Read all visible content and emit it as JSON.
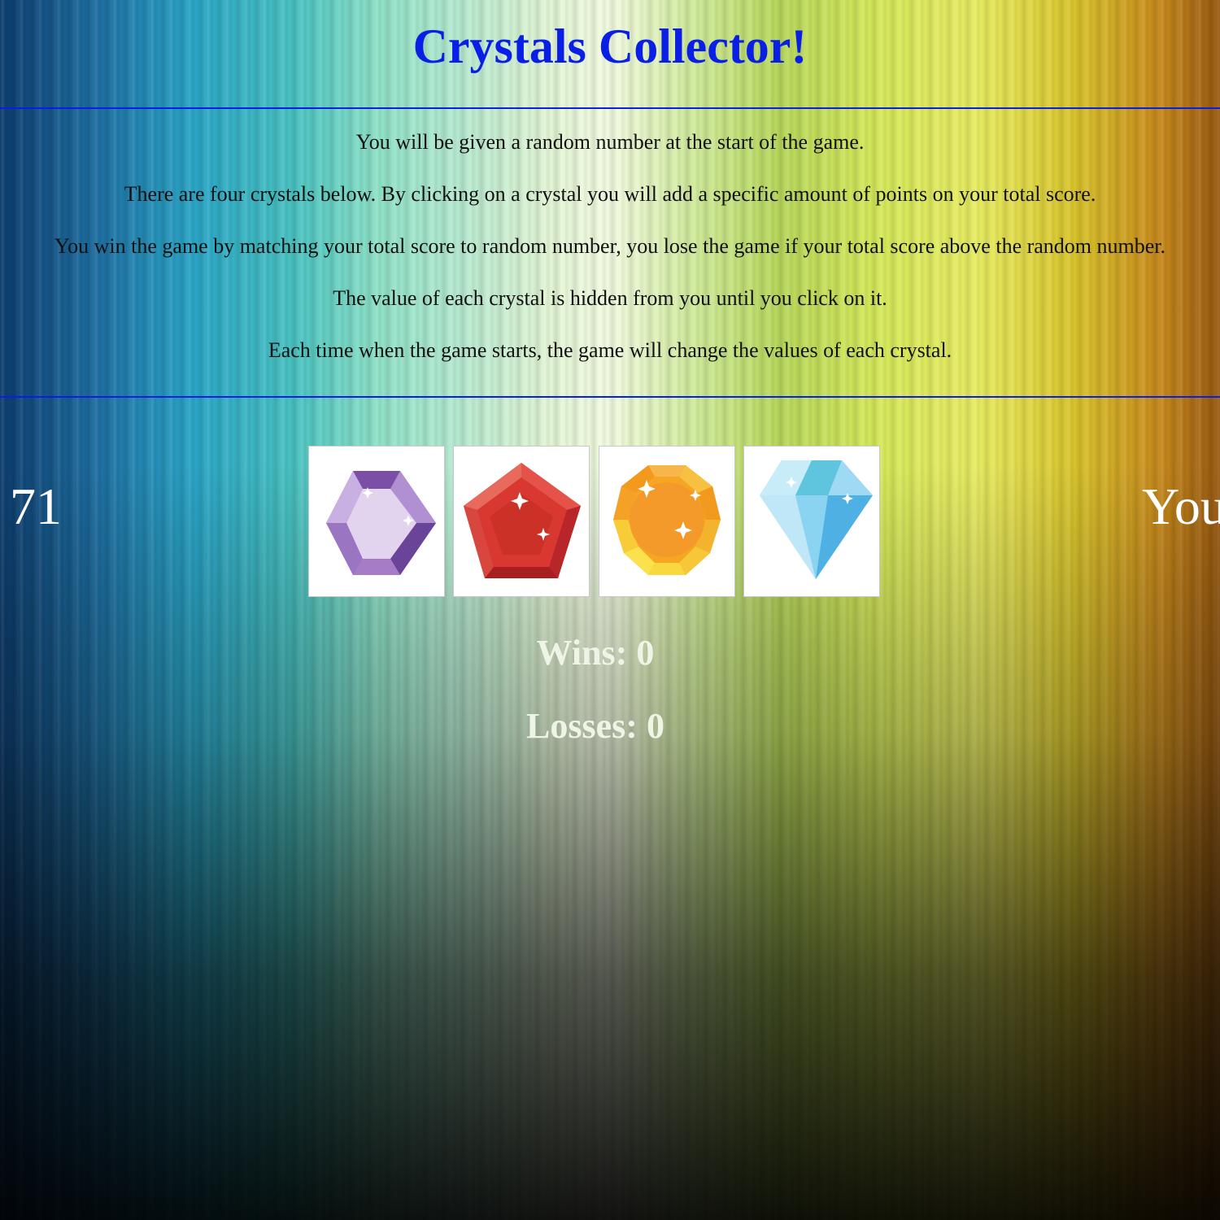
{
  "title": "Crystals Collector!",
  "instructions": [
    "You will be given a random number at the start of the game.",
    "There are four crystals below. By clicking on a crystal you will add a specific amount of points on your total score.",
    "You win the game by matching your total score to random number, you lose the game if your total score above the random number.",
    "The value of each crystal is hidden from you until you click on it.",
    "Each time when the game starts, the game will change the values of each crystal."
  ],
  "game": {
    "random_number": "71",
    "score_label": "You",
    "wins": "Wins: 0",
    "losses": "Losses: 0"
  },
  "crystals": [
    {
      "name": "purple-hexagon-crystal-icon",
      "color": "#9b6fc0"
    },
    {
      "name": "red-pentagon-crystal-icon",
      "color": "#d8382f"
    },
    {
      "name": "orange-round-crystal-icon",
      "color": "#f3a52e"
    },
    {
      "name": "blue-diamond-crystal-icon",
      "color": "#6cc8ef"
    }
  ],
  "colors": {
    "title": "#0a1fe6",
    "rule": "#0a1fe6",
    "tally": "#eef5e6",
    "number": "#ffffff"
  }
}
